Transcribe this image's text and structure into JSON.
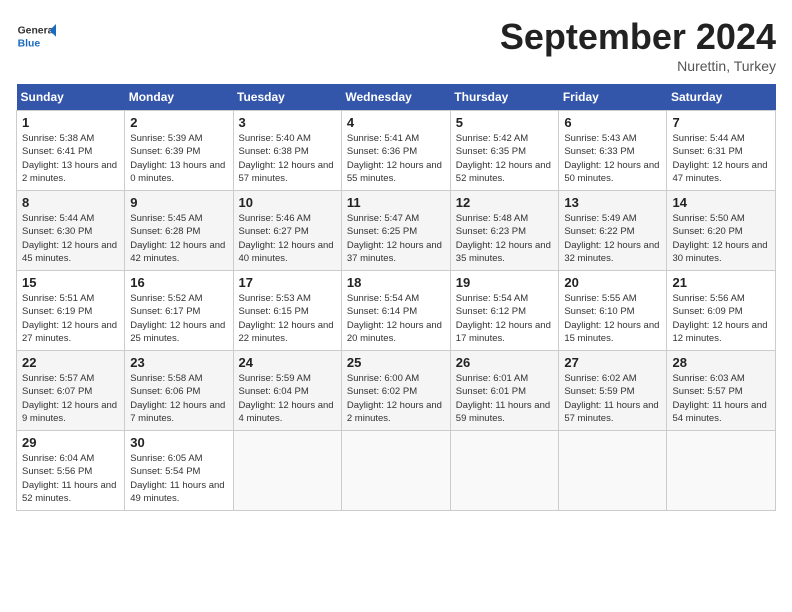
{
  "header": {
    "logo_general": "General",
    "logo_blue": "Blue",
    "month": "September 2024",
    "location": "Nurettin, Turkey"
  },
  "weekdays": [
    "Sunday",
    "Monday",
    "Tuesday",
    "Wednesday",
    "Thursday",
    "Friday",
    "Saturday"
  ],
  "weeks": [
    [
      {
        "day": "1",
        "sunrise": "Sunrise: 5:38 AM",
        "sunset": "Sunset: 6:41 PM",
        "daylight": "Daylight: 13 hours and 2 minutes."
      },
      {
        "day": "2",
        "sunrise": "Sunrise: 5:39 AM",
        "sunset": "Sunset: 6:39 PM",
        "daylight": "Daylight: 13 hours and 0 minutes."
      },
      {
        "day": "3",
        "sunrise": "Sunrise: 5:40 AM",
        "sunset": "Sunset: 6:38 PM",
        "daylight": "Daylight: 12 hours and 57 minutes."
      },
      {
        "day": "4",
        "sunrise": "Sunrise: 5:41 AM",
        "sunset": "Sunset: 6:36 PM",
        "daylight": "Daylight: 12 hours and 55 minutes."
      },
      {
        "day": "5",
        "sunrise": "Sunrise: 5:42 AM",
        "sunset": "Sunset: 6:35 PM",
        "daylight": "Daylight: 12 hours and 52 minutes."
      },
      {
        "day": "6",
        "sunrise": "Sunrise: 5:43 AM",
        "sunset": "Sunset: 6:33 PM",
        "daylight": "Daylight: 12 hours and 50 minutes."
      },
      {
        "day": "7",
        "sunrise": "Sunrise: 5:44 AM",
        "sunset": "Sunset: 6:31 PM",
        "daylight": "Daylight: 12 hours and 47 minutes."
      }
    ],
    [
      {
        "day": "8",
        "sunrise": "Sunrise: 5:44 AM",
        "sunset": "Sunset: 6:30 PM",
        "daylight": "Daylight: 12 hours and 45 minutes."
      },
      {
        "day": "9",
        "sunrise": "Sunrise: 5:45 AM",
        "sunset": "Sunset: 6:28 PM",
        "daylight": "Daylight: 12 hours and 42 minutes."
      },
      {
        "day": "10",
        "sunrise": "Sunrise: 5:46 AM",
        "sunset": "Sunset: 6:27 PM",
        "daylight": "Daylight: 12 hours and 40 minutes."
      },
      {
        "day": "11",
        "sunrise": "Sunrise: 5:47 AM",
        "sunset": "Sunset: 6:25 PM",
        "daylight": "Daylight: 12 hours and 37 minutes."
      },
      {
        "day": "12",
        "sunrise": "Sunrise: 5:48 AM",
        "sunset": "Sunset: 6:23 PM",
        "daylight": "Daylight: 12 hours and 35 minutes."
      },
      {
        "day": "13",
        "sunrise": "Sunrise: 5:49 AM",
        "sunset": "Sunset: 6:22 PM",
        "daylight": "Daylight: 12 hours and 32 minutes."
      },
      {
        "day": "14",
        "sunrise": "Sunrise: 5:50 AM",
        "sunset": "Sunset: 6:20 PM",
        "daylight": "Daylight: 12 hours and 30 minutes."
      }
    ],
    [
      {
        "day": "15",
        "sunrise": "Sunrise: 5:51 AM",
        "sunset": "Sunset: 6:19 PM",
        "daylight": "Daylight: 12 hours and 27 minutes."
      },
      {
        "day": "16",
        "sunrise": "Sunrise: 5:52 AM",
        "sunset": "Sunset: 6:17 PM",
        "daylight": "Daylight: 12 hours and 25 minutes."
      },
      {
        "day": "17",
        "sunrise": "Sunrise: 5:53 AM",
        "sunset": "Sunset: 6:15 PM",
        "daylight": "Daylight: 12 hours and 22 minutes."
      },
      {
        "day": "18",
        "sunrise": "Sunrise: 5:54 AM",
        "sunset": "Sunset: 6:14 PM",
        "daylight": "Daylight: 12 hours and 20 minutes."
      },
      {
        "day": "19",
        "sunrise": "Sunrise: 5:54 AM",
        "sunset": "Sunset: 6:12 PM",
        "daylight": "Daylight: 12 hours and 17 minutes."
      },
      {
        "day": "20",
        "sunrise": "Sunrise: 5:55 AM",
        "sunset": "Sunset: 6:10 PM",
        "daylight": "Daylight: 12 hours and 15 minutes."
      },
      {
        "day": "21",
        "sunrise": "Sunrise: 5:56 AM",
        "sunset": "Sunset: 6:09 PM",
        "daylight": "Daylight: 12 hours and 12 minutes."
      }
    ],
    [
      {
        "day": "22",
        "sunrise": "Sunrise: 5:57 AM",
        "sunset": "Sunset: 6:07 PM",
        "daylight": "Daylight: 12 hours and 9 minutes."
      },
      {
        "day": "23",
        "sunrise": "Sunrise: 5:58 AM",
        "sunset": "Sunset: 6:06 PM",
        "daylight": "Daylight: 12 hours and 7 minutes."
      },
      {
        "day": "24",
        "sunrise": "Sunrise: 5:59 AM",
        "sunset": "Sunset: 6:04 PM",
        "daylight": "Daylight: 12 hours and 4 minutes."
      },
      {
        "day": "25",
        "sunrise": "Sunrise: 6:00 AM",
        "sunset": "Sunset: 6:02 PM",
        "daylight": "Daylight: 12 hours and 2 minutes."
      },
      {
        "day": "26",
        "sunrise": "Sunrise: 6:01 AM",
        "sunset": "Sunset: 6:01 PM",
        "daylight": "Daylight: 11 hours and 59 minutes."
      },
      {
        "day": "27",
        "sunrise": "Sunrise: 6:02 AM",
        "sunset": "Sunset: 5:59 PM",
        "daylight": "Daylight: 11 hours and 57 minutes."
      },
      {
        "day": "28",
        "sunrise": "Sunrise: 6:03 AM",
        "sunset": "Sunset: 5:57 PM",
        "daylight": "Daylight: 11 hours and 54 minutes."
      }
    ],
    [
      {
        "day": "29",
        "sunrise": "Sunrise: 6:04 AM",
        "sunset": "Sunset: 5:56 PM",
        "daylight": "Daylight: 11 hours and 52 minutes."
      },
      {
        "day": "30",
        "sunrise": "Sunrise: 6:05 AM",
        "sunset": "Sunset: 5:54 PM",
        "daylight": "Daylight: 11 hours and 49 minutes."
      },
      null,
      null,
      null,
      null,
      null
    ]
  ]
}
